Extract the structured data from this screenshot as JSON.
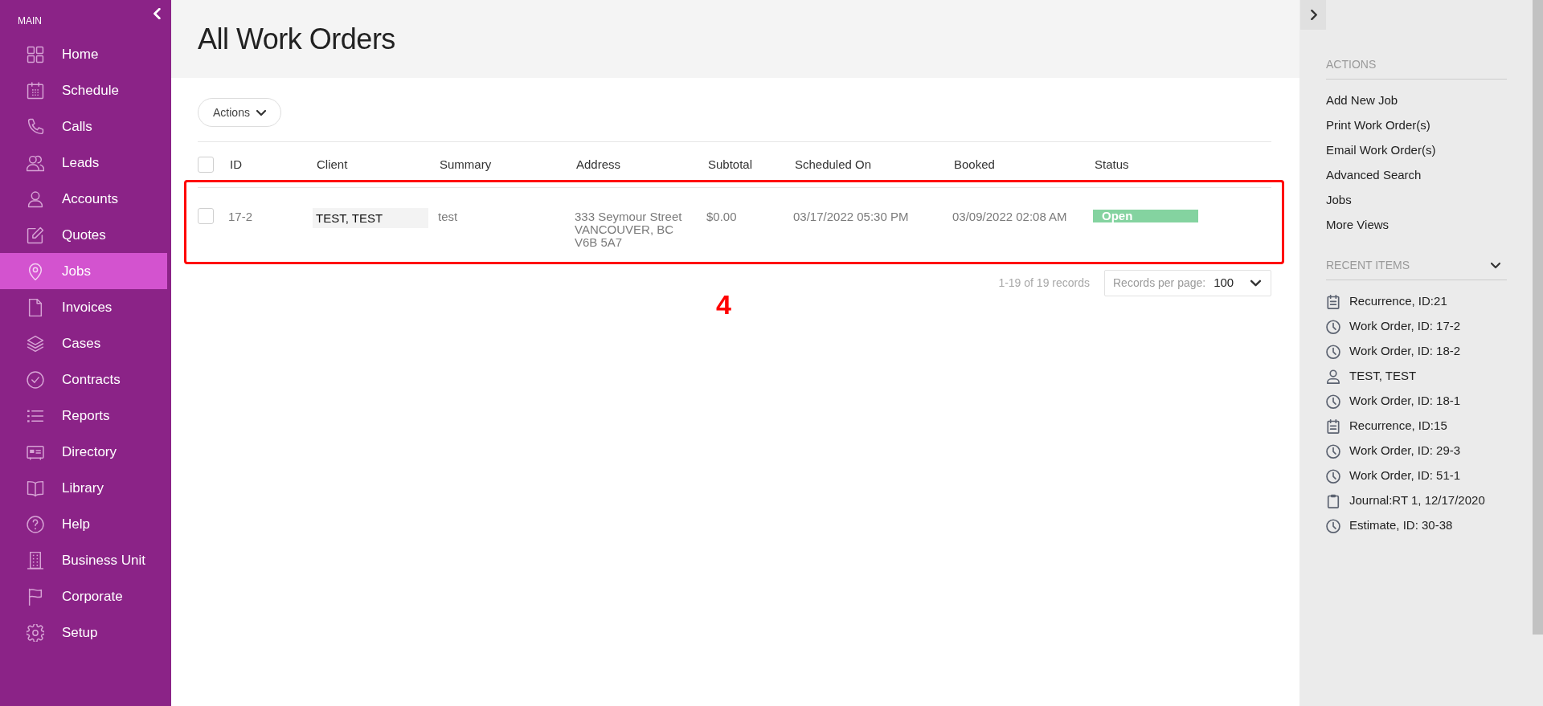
{
  "sidebar": {
    "section_label": "MAIN",
    "items": [
      {
        "label": "Home",
        "selected": false
      },
      {
        "label": "Schedule",
        "selected": false
      },
      {
        "label": "Calls",
        "selected": false
      },
      {
        "label": "Leads",
        "selected": false
      },
      {
        "label": "Accounts",
        "selected": false
      },
      {
        "label": "Quotes",
        "selected": false
      },
      {
        "label": "Jobs",
        "selected": true
      },
      {
        "label": "Invoices",
        "selected": false
      },
      {
        "label": "Cases",
        "selected": false
      },
      {
        "label": "Contracts",
        "selected": false
      },
      {
        "label": "Reports",
        "selected": false
      },
      {
        "label": "Directory",
        "selected": false
      },
      {
        "label": "Library",
        "selected": false
      },
      {
        "label": "Help",
        "selected": false
      },
      {
        "label": "Business Unit",
        "selected": false
      },
      {
        "label": "Corporate",
        "selected": false
      },
      {
        "label": "Setup",
        "selected": false
      }
    ]
  },
  "header": {
    "title": "All Work Orders"
  },
  "toolbar": {
    "actions_button": "Actions"
  },
  "table": {
    "select_all_checked": false,
    "columns": [
      "ID",
      "Client",
      "Summary",
      "Address",
      "Subtotal",
      "Scheduled On",
      "Booked",
      "Status"
    ],
    "rows": [
      {
        "checked": false,
        "id": "17-2",
        "client": "TEST, TEST",
        "summary": "test",
        "address": [
          "333 Seymour Street",
          "VANCOUVER, BC",
          "V6B 5A7"
        ],
        "subtotal": "$0.00",
        "scheduled_on": "03/17/2022 05:30 PM",
        "booked": "03/09/2022 02:08 AM",
        "status": {
          "label": "Open",
          "color": "#84d3a0"
        }
      }
    ]
  },
  "annotation": {
    "label": "4"
  },
  "pagination": {
    "summary": "1-19 of 19 records",
    "per_page_label": "Records per page:",
    "per_page_value": "100"
  },
  "right_panel": {
    "actions_heading": "ACTIONS",
    "actions": [
      "Add New Job",
      "Print Work Order(s)",
      "Email Work Order(s)",
      "Advanced Search",
      "Jobs",
      "More Views"
    ],
    "recent_heading": "RECENT ITEMS",
    "recent_expanded": true,
    "recent_items": [
      {
        "kind": "recurrence",
        "label": "Recurrence, ID:21"
      },
      {
        "kind": "work_order",
        "label": "Work Order, ID: 17-2"
      },
      {
        "kind": "work_order",
        "label": "Work Order, ID: 18-2"
      },
      {
        "kind": "contact",
        "label": "TEST, TEST"
      },
      {
        "kind": "work_order",
        "label": "Work Order, ID: 18-1"
      },
      {
        "kind": "recurrence",
        "label": "Recurrence, ID:15"
      },
      {
        "kind": "work_order",
        "label": "Work Order, ID: 29-3"
      },
      {
        "kind": "work_order",
        "label": "Work Order, ID: 51-1"
      },
      {
        "kind": "journal",
        "label": "Journal:RT 1, 12/17/2020"
      },
      {
        "kind": "estimate",
        "label": "Estimate, ID: 30-38"
      }
    ]
  }
}
